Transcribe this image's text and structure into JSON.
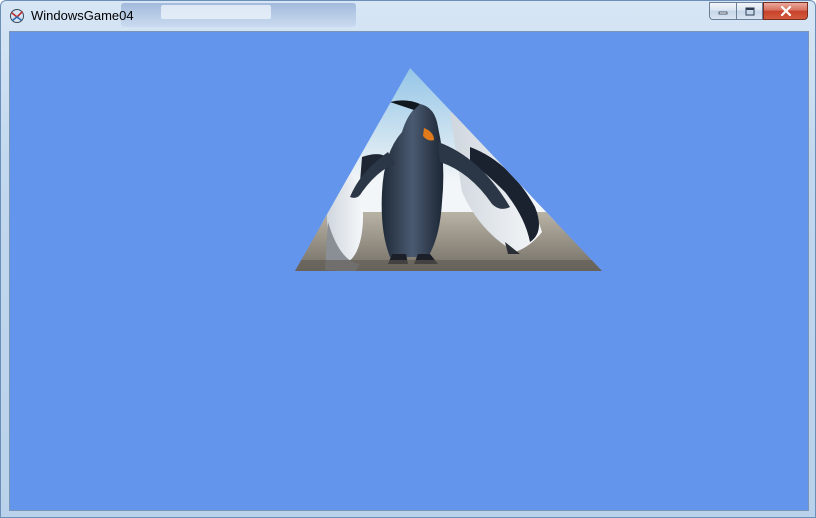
{
  "window": {
    "title": "WindowsGame04",
    "icon": "xna-game-icon",
    "controls": [
      "minimize-icon",
      "maximize-icon",
      "close-icon"
    ]
  },
  "scene": {
    "background_color": "#6495ED",
    "shape": "triangle",
    "texture": "penguins-photo"
  }
}
